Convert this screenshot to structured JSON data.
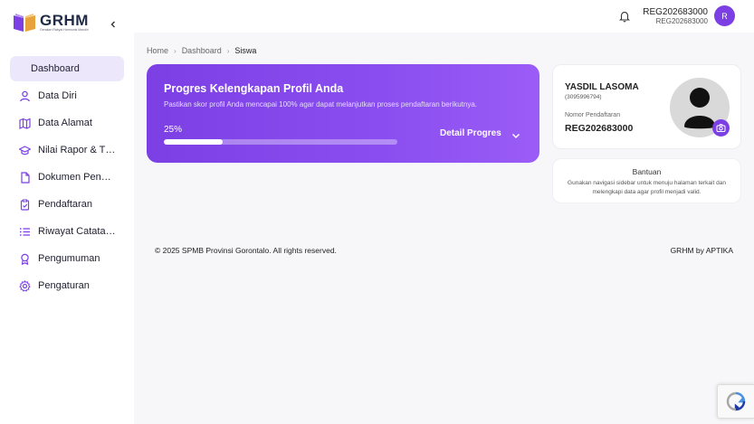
{
  "brand": {
    "title": "GRHM",
    "subtitle": "Gerakan Rakyat Harmonis Mandiri"
  },
  "sidebar": {
    "items": [
      {
        "label": "Dashboard",
        "icon": "grid-icon",
        "active": true
      },
      {
        "label": "Data Diri",
        "icon": "user-icon"
      },
      {
        "label": "Data Alamat",
        "icon": "map-icon"
      },
      {
        "label": "Nilai Rapor & TKA",
        "icon": "graduation-cap-icon"
      },
      {
        "label": "Dokumen Pendaftaran",
        "icon": "document-icon"
      },
      {
        "label": "Pendaftaran",
        "icon": "clipboard-check-icon"
      },
      {
        "label": "Riwayat Catatan Data",
        "icon": "list-icon"
      },
      {
        "label": "Pengumuman",
        "icon": "award-icon"
      },
      {
        "label": "Pengaturan",
        "icon": "gear-icon"
      }
    ]
  },
  "topbar": {
    "user_name": "REG202683000",
    "user_id": "REG202683000",
    "avatar_initial": "R"
  },
  "breadcrumb": [
    "Home",
    "Dashboard",
    "Siswa"
  ],
  "progress": {
    "title": "Progres Kelengkapan Profil Anda",
    "subtitle": "Pastikan skor profil Anda mencapai 100% agar dapat melanjutkan proses pendaftaran berikutnya.",
    "percent_label": "25%",
    "percent": 25,
    "detail_label": "Detail Progres"
  },
  "profile": {
    "name": "YASDIL LASOMA",
    "nisn": "(3095996794)",
    "reg_label": "Nomor Pendaftaran",
    "reg_number": "REG202683000"
  },
  "help": {
    "title": "Bantuan",
    "text": "Gunakan navigasi sidebar untuk menuju halaman terkait dan melengkapi data agar profil menjadi valid."
  },
  "footer": {
    "copyright": "© 2025 SPMB Provinsi Gorontalo. All rights reserved.",
    "credit": "GRHM by APTIKA"
  },
  "colors": {
    "accent": "#7b3fe4",
    "accent_light": "#ede7fb"
  }
}
